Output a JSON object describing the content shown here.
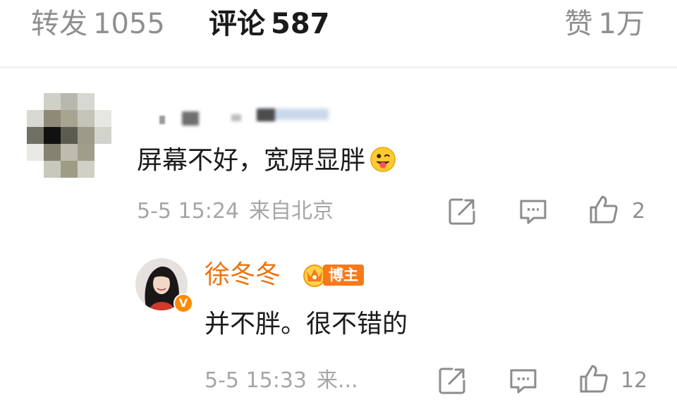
{
  "tabs": {
    "repost": {
      "label": "转发",
      "count": "1055"
    },
    "comment": {
      "label": "评论",
      "count": "587"
    },
    "like": {
      "label": "赞",
      "count": "1万"
    }
  },
  "comments": [
    {
      "text": "屏幕不好，宽屏显胖",
      "emoji": "tongue-wink-emoji",
      "time": "5-5 15:24",
      "location": "来自北京",
      "likes": "2",
      "icons": [
        "share-icon",
        "comment-icon",
        "thumbs-up-icon"
      ]
    },
    {
      "user": "徐冬冬",
      "badge": "博主",
      "verified": "V",
      "text": "并不胖。很不错的",
      "time": "5-5 15:33",
      "location": "来...",
      "likes": "12",
      "icons": [
        "share-icon",
        "comment-icon",
        "thumbs-up-icon"
      ]
    }
  ],
  "colors": {
    "accent": "#eb7412",
    "muted": "#a6a6a6",
    "text": "#1b1b1b"
  }
}
